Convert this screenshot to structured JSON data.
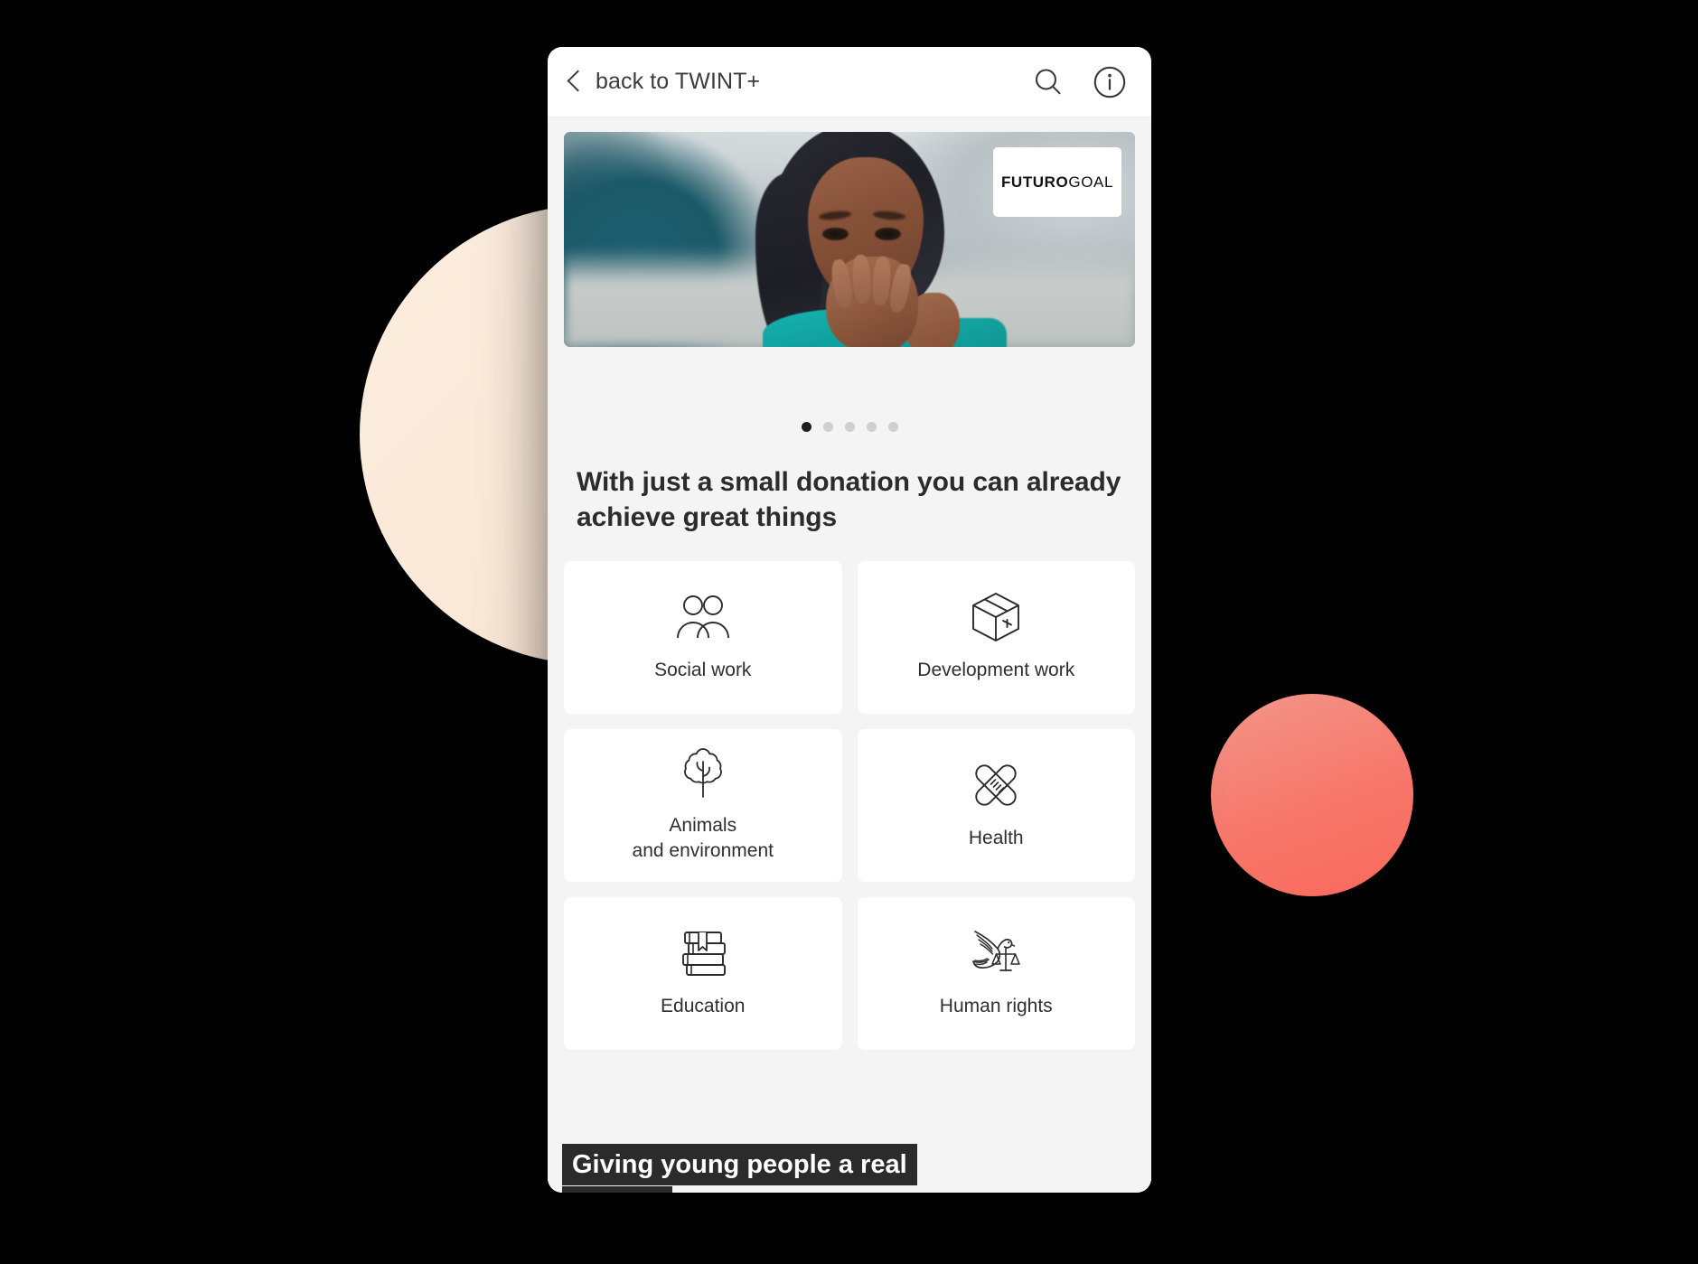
{
  "decor": {
    "cream_circle_color": "#fae8d7",
    "coral_circle_color": "#f7776a",
    "background_color": "#000000"
  },
  "header": {
    "back_label": "back to TWINT+",
    "back_icon": "chevron-left-icon",
    "search_icon": "search-icon",
    "info_icon": "info-circle-icon"
  },
  "hero": {
    "logo_bold": "FUTURO",
    "logo_light": "GOAL",
    "title": "Giving young people a real chance",
    "image_alt": "young girl with braids smiling with hands near her mouth"
  },
  "carousel": {
    "total": 5,
    "active_index": 0,
    "dots": [
      {
        "active": true
      },
      {
        "active": false
      },
      {
        "active": false
      },
      {
        "active": false
      },
      {
        "active": false
      }
    ]
  },
  "section": {
    "heading": "With just a small donation you can already achieve great things"
  },
  "categories": [
    {
      "label": "Social work",
      "icon": "two-people-icon"
    },
    {
      "label": "Development work",
      "icon": "package-box-plus-icon"
    },
    {
      "label": "Animals\nand environment",
      "icon": "tree-icon"
    },
    {
      "label": "Health",
      "icon": "crossed-bandages-icon"
    },
    {
      "label": "Education",
      "icon": "book-stack-icon"
    },
    {
      "label": "Human rights",
      "icon": "dove-scales-icon"
    }
  ]
}
